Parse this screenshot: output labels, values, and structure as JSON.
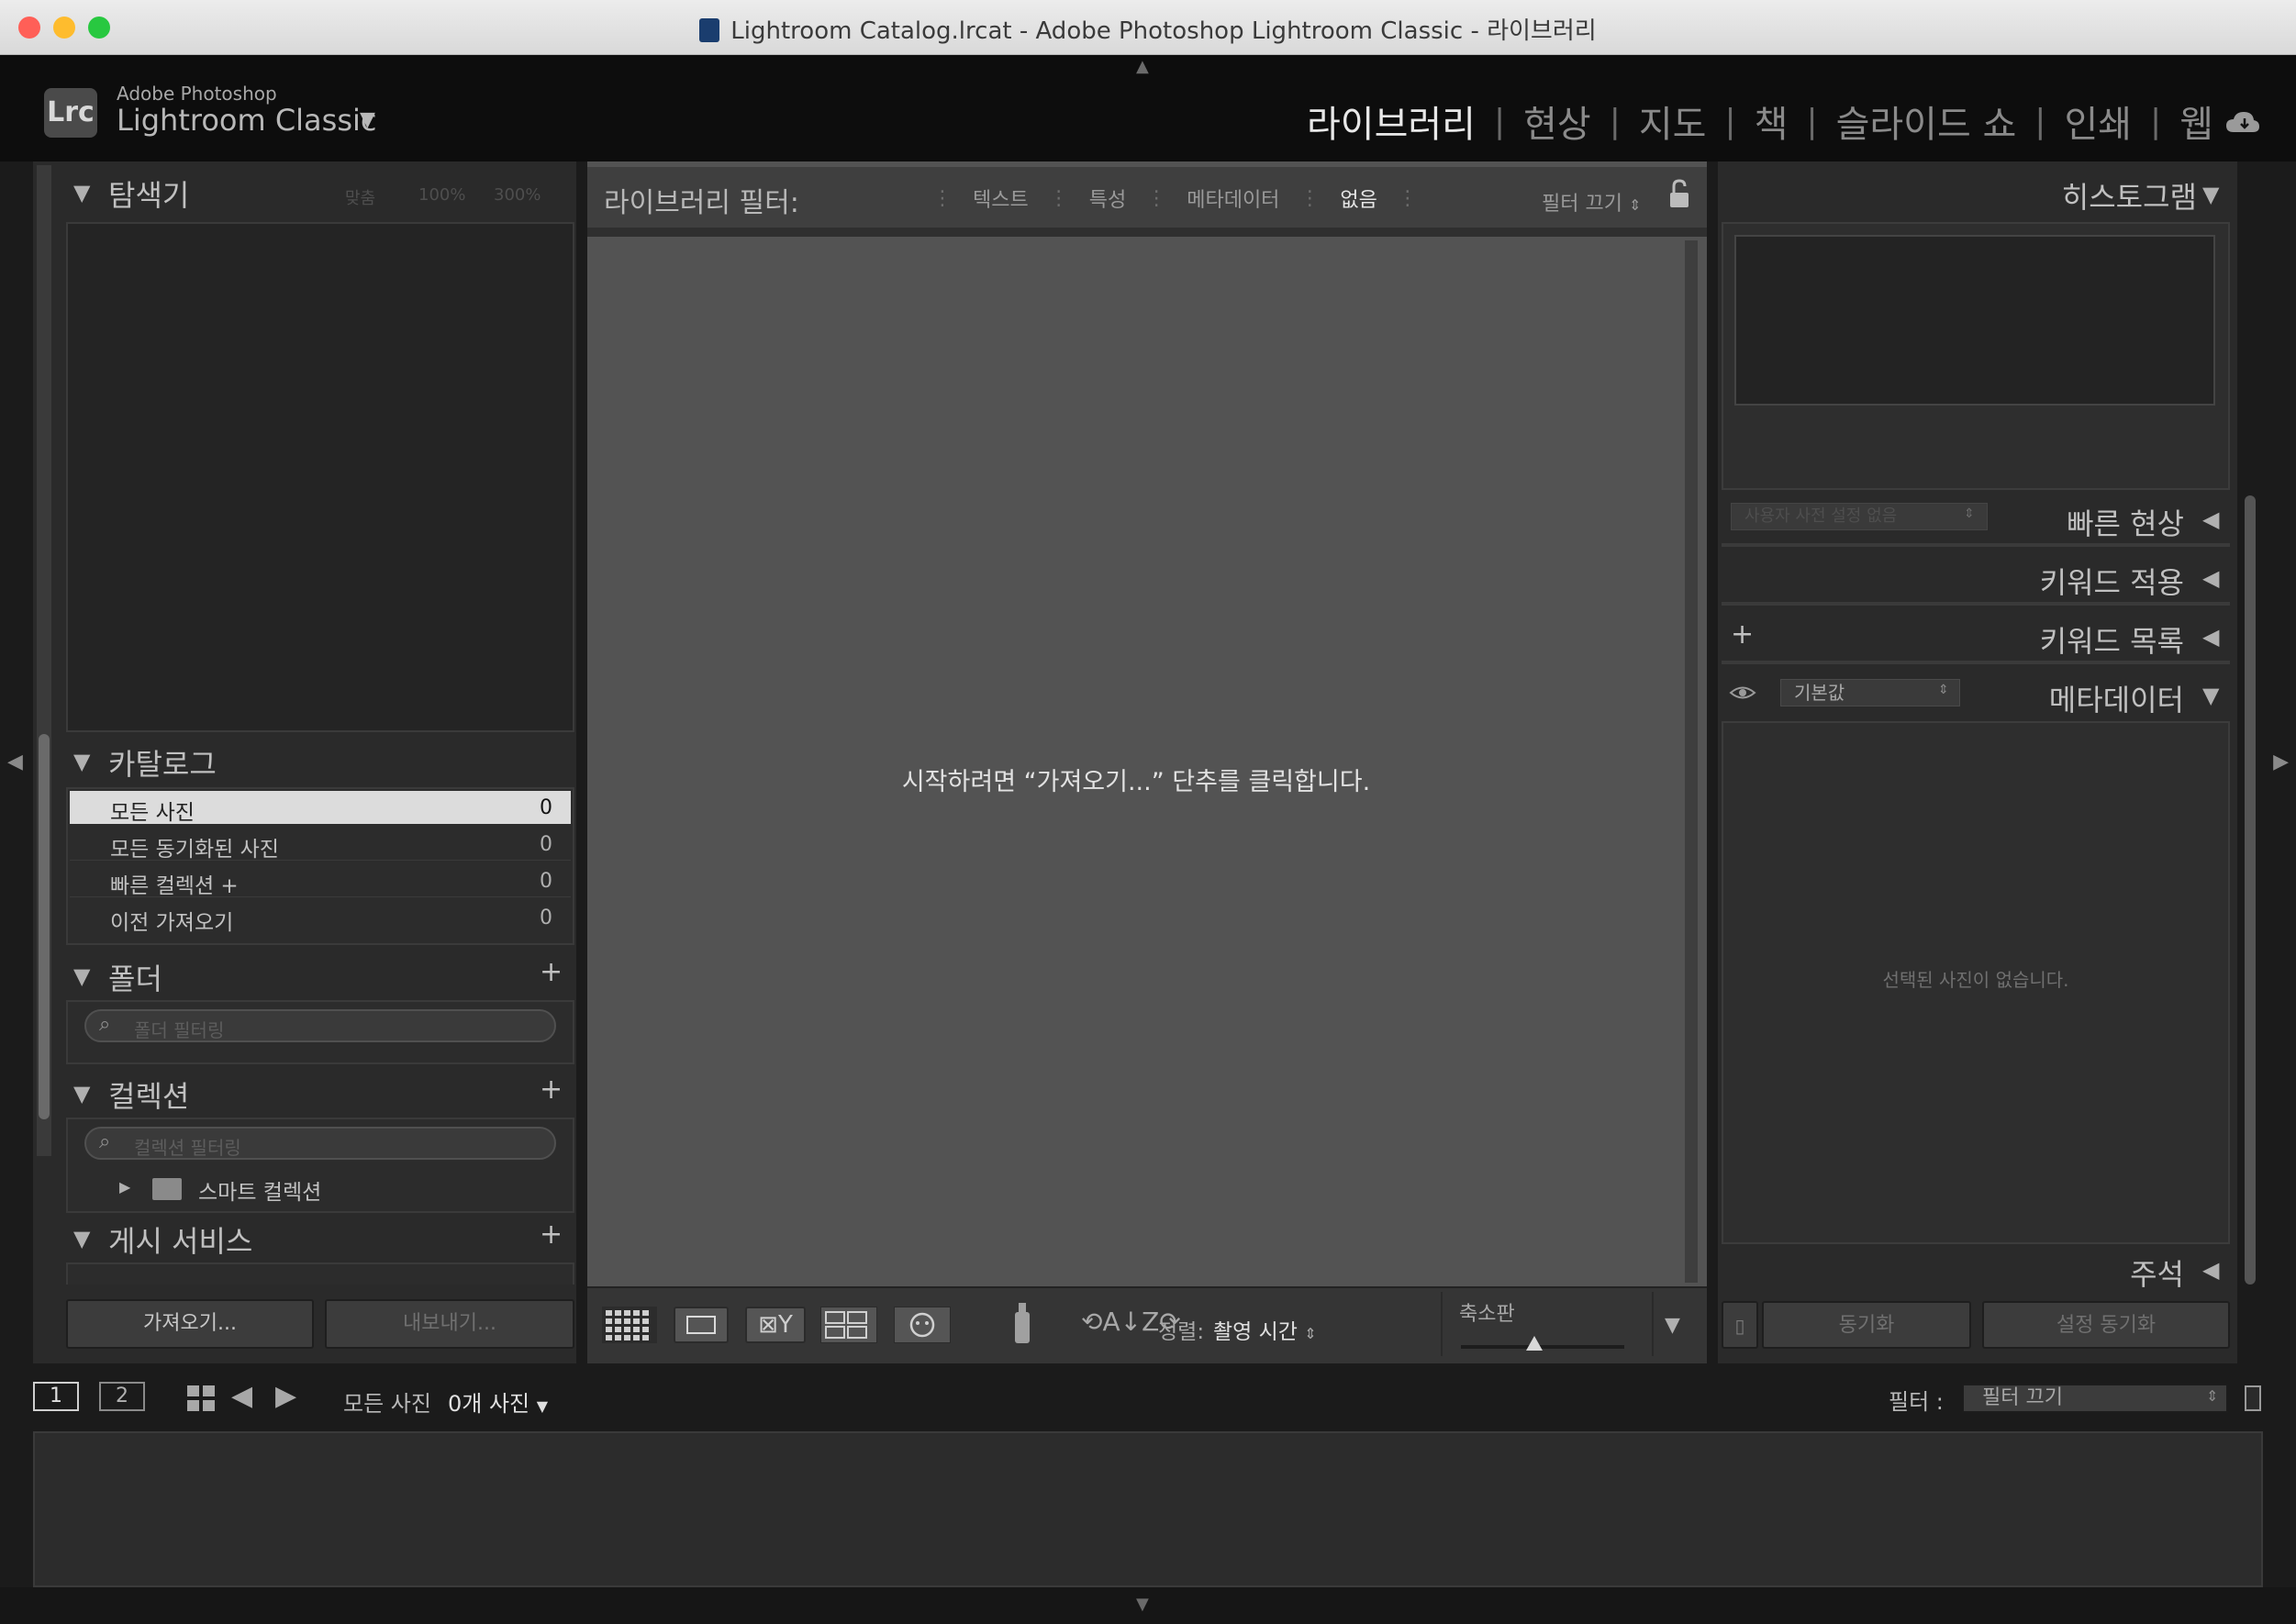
{
  "window": {
    "title": "Lightroom Catalog.lrcat - Adobe Photoshop Lightroom Classic - 라이브러리"
  },
  "brand": {
    "logo": "Lrc",
    "line1": "Adobe Photoshop",
    "line2": "Lightroom Classic",
    "caret": "▼"
  },
  "modules": [
    "라이브러리",
    "현상",
    "지도",
    "책",
    "슬라이드 쇼",
    "인쇄",
    "웹"
  ],
  "left": {
    "navigator": {
      "title": "탐색기",
      "zoom_opts": [
        "맞춤",
        "100%",
        "300%"
      ]
    },
    "catalog": {
      "title": "카탈로그",
      "items": [
        {
          "label": "모든 사진",
          "count": "0"
        },
        {
          "label": "모든 동기화된 사진",
          "count": "0"
        },
        {
          "label": "빠른 컬렉션 +",
          "count": "0"
        },
        {
          "label": "이전 가져오기",
          "count": "0"
        }
      ]
    },
    "folders": {
      "title": "폴더",
      "search_placeholder": "폴더 필터링"
    },
    "collections": {
      "title": "컬렉션",
      "search_placeholder": "컬렉션 필터링",
      "smart": "스마트 컬렉션"
    },
    "publish": {
      "title": "게시 서비스"
    },
    "import_label": "가져오기...",
    "export_label": "내보내기..."
  },
  "filter": {
    "label": "라이브러리 필터:",
    "options": [
      "텍스트",
      "특성",
      "메타데이터",
      "없음"
    ],
    "preset": "필터 끄기"
  },
  "center": {
    "message": "시작하려면 “가져오기...” 단추를 클릭합니다."
  },
  "toolbar": {
    "sort_label": "정렬:",
    "sort_value": "촬영 시간",
    "thumb_label": "축소판",
    "thumb_level": 0.45
  },
  "right": {
    "histogram": {
      "title": "히스토그램"
    },
    "quick_develop": {
      "title": "빠른 현상",
      "preset": "사용자 사전 설정 없음"
    },
    "keywording": {
      "title": "키워드 적용"
    },
    "keyword_list": {
      "title": "키워드 목록"
    },
    "metadata": {
      "title": "메타데이터",
      "preset": "기본값",
      "empty": "선택된 사진이 없습니다."
    },
    "comments": {
      "title": "주석"
    },
    "sync_label": "동기화",
    "sync_settings_label": "설정 동기화"
  },
  "filmnav": {
    "view1": "1",
    "view2": "2",
    "source": "모든 사진",
    "photo_count": "0개 사진",
    "filter_label": "필터 :",
    "filter_value": "필터 끄기"
  }
}
